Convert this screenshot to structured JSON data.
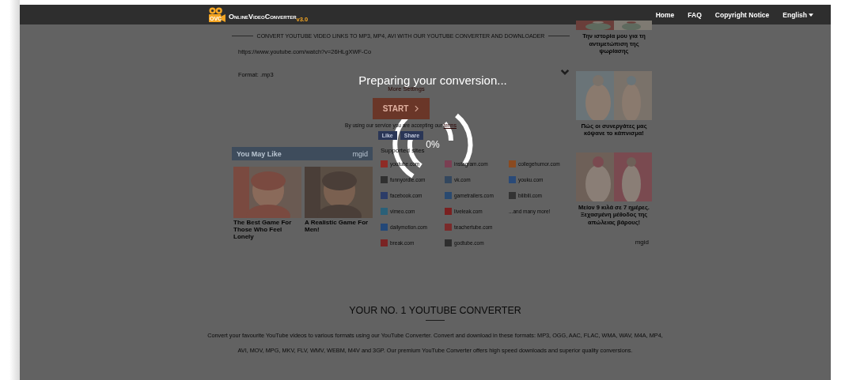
{
  "nav": {
    "logo_text": "OnlineVideoConverter",
    "logo_version": "v3.0",
    "logo_badge": "OVC",
    "links": [
      {
        "label": "Home",
        "kind": "link"
      },
      {
        "label": "FAQ",
        "kind": "link"
      },
      {
        "label": "Copyright Notice",
        "kind": "link"
      },
      {
        "label": "English",
        "kind": "dropdown"
      }
    ]
  },
  "converter": {
    "heading": "CONVERT YOUTUBE VIDEO LINKS TO MP3, MP4, AVI WITH OUR YOUTUBE CONVERTER AND DOWNLOADER",
    "url": "https://www.youtube.com/watch?v=26HLgXWF-Co",
    "format": "Format: .mp3",
    "more_settings": "More Settings",
    "start": "START",
    "terms": "By using our service you are accepting our",
    "terms_link": "terms",
    "like": "Like",
    "share": "Share"
  },
  "you_may_like": {
    "title": "You May Like",
    "brand": "mgid",
    "items": [
      {
        "caption": "The Best Game For Those Who Feel Lonely",
        "kind": "picture"
      },
      {
        "caption": "A Realistic Game For Men!",
        "kind": "picture"
      }
    ]
  },
  "supported_sites": {
    "heading": "Supported sites",
    "sites": [
      {
        "name": "youtube.com",
        "color": "#8e2b25"
      },
      {
        "name": "funnyordie.com",
        "color": "#303030"
      },
      {
        "name": "facebook.com",
        "color": "#2c3c68"
      },
      {
        "name": "vimeo.com",
        "color": "#2a6078"
      },
      {
        "name": "dailymotion.com",
        "color": "#244878"
      },
      {
        "name": "break.com",
        "color": "#7a2424"
      },
      {
        "name": "instagram.com",
        "color": "#7a3f52"
      },
      {
        "name": "vk.com",
        "color": "#33475e"
      },
      {
        "name": "gametrailers.com",
        "color": "#2a4a70"
      },
      {
        "name": "liveleak.com",
        "color": "#7a2020"
      },
      {
        "name": "teachertube.com",
        "color": "#7a2a2a"
      },
      {
        "name": "godtube.com",
        "color": "#2e2e2e"
      },
      {
        "name": "collegehumor.com",
        "color": "#8a4a20"
      },
      {
        "name": "youku.com",
        "color": "#2a4a78"
      },
      {
        "name": "bilibili.com",
        "color": "#333333"
      }
    ],
    "more": "...and many more!"
  },
  "side_ads": {
    "items": [
      {
        "caption": "Την ιστορία μου για τη αντιμετώπιση της ψωρίασης",
        "kind": "picture"
      },
      {
        "caption": "Πώς οι συνεργάτες μας κόψανε το κάπνισμα!",
        "kind": "picture"
      },
      {
        "caption": "Μείον 9 κιλά σε 7 ημέρες. Ξεχασμένη μέθοδος της απώλειας βάρους!",
        "kind": "picture"
      }
    ],
    "brand": "mgid"
  },
  "about": {
    "heading": "YOUR NO. 1 YOUTUBE CONVERTER",
    "text": "Convert your favourite YouTube videos to various formats using our YouTube Converter. Convert and download in these formats: MP3, OGG, AAC, FLAC, WMA, WAV, M4A, MP4, AVI, MOV, MPG, MKV, FLV, WMV, WEBM, M4V and 3GP. Our premium YouTube Converter offers high speed downloads and superior quality conversions."
  },
  "overlay": {
    "message": "Preparing your conversion...",
    "progress": "0%"
  }
}
